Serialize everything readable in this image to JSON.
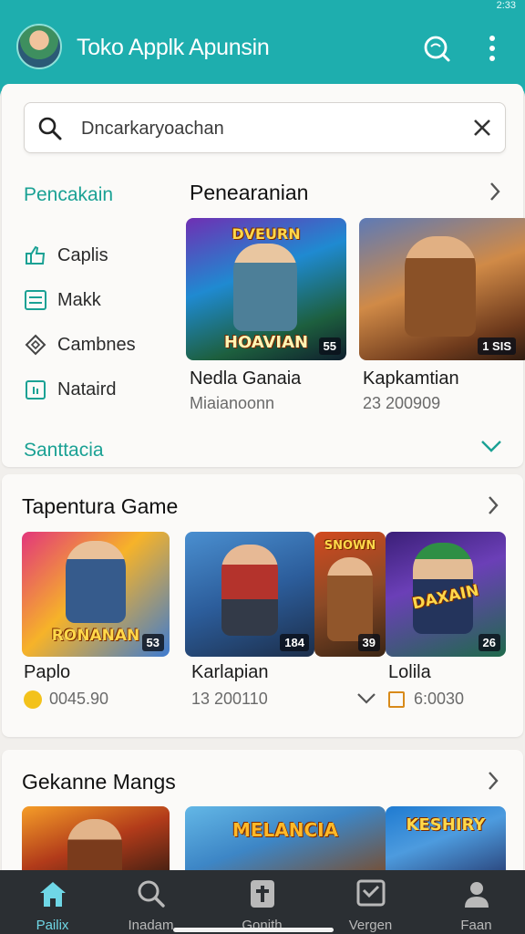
{
  "status": {
    "time": "2:33"
  },
  "appbar": {
    "title": "Toko Applk Apunsin",
    "search_icon": "search-icon",
    "menu_icon": "more-vert-icon",
    "accent": "#1eaeae"
  },
  "search": {
    "value": "Dncarkaryoachan"
  },
  "filter": {
    "title": "Pencakain",
    "items": [
      {
        "label": "Caplis",
        "icon": "thumb-icon"
      },
      {
        "label": "Makk",
        "icon": "list-icon"
      },
      {
        "label": "Cambnes",
        "icon": "gem-icon"
      },
      {
        "label": "Nataird",
        "icon": "calendar-icon"
      }
    ],
    "footer": "Santtacia"
  },
  "featured": {
    "title": "Penearanian",
    "apps": [
      {
        "name": "Nedla Ganaia",
        "meta": "Miaianoonn",
        "badge": "55",
        "art_text": "HOAVIAN",
        "top_text": "DVEURN"
      },
      {
        "name": "Kapkamtian",
        "meta": "23 200909",
        "badge": "1 SIS",
        "art_text": "",
        "top_text": ""
      }
    ]
  },
  "popular": {
    "title": "Tapentura Game",
    "apps": [
      {
        "name": "Paplo",
        "meta": "0045.90",
        "badge": "53",
        "art_text": "RONANAN"
      },
      {
        "name": "Karlapian",
        "meta": "13 200110",
        "badge": "184",
        "art_text": ""
      },
      {
        "name": "",
        "meta": "",
        "badge": "39",
        "art_text": "SNOWN"
      },
      {
        "name": "Lolila",
        "meta": "6:0030",
        "badge": "26",
        "art_text": "DAXAIN"
      }
    ]
  },
  "third": {
    "title": "Gekanne Mangs",
    "apps": [
      {
        "art_text": ""
      },
      {
        "art_text": "MELANCIA"
      },
      {
        "art_text": "KESHIRY"
      }
    ]
  },
  "bottom_nav": [
    {
      "label": "Pailix",
      "icon": "home-icon",
      "active": true
    },
    {
      "label": "Inadam",
      "icon": "search-icon",
      "active": false
    },
    {
      "label": "Gonith",
      "icon": "tablet-icon",
      "active": false
    },
    {
      "label": "Vergen",
      "icon": "inbox-icon",
      "active": false
    },
    {
      "label": "Faan",
      "icon": "person-icon",
      "active": false
    }
  ]
}
